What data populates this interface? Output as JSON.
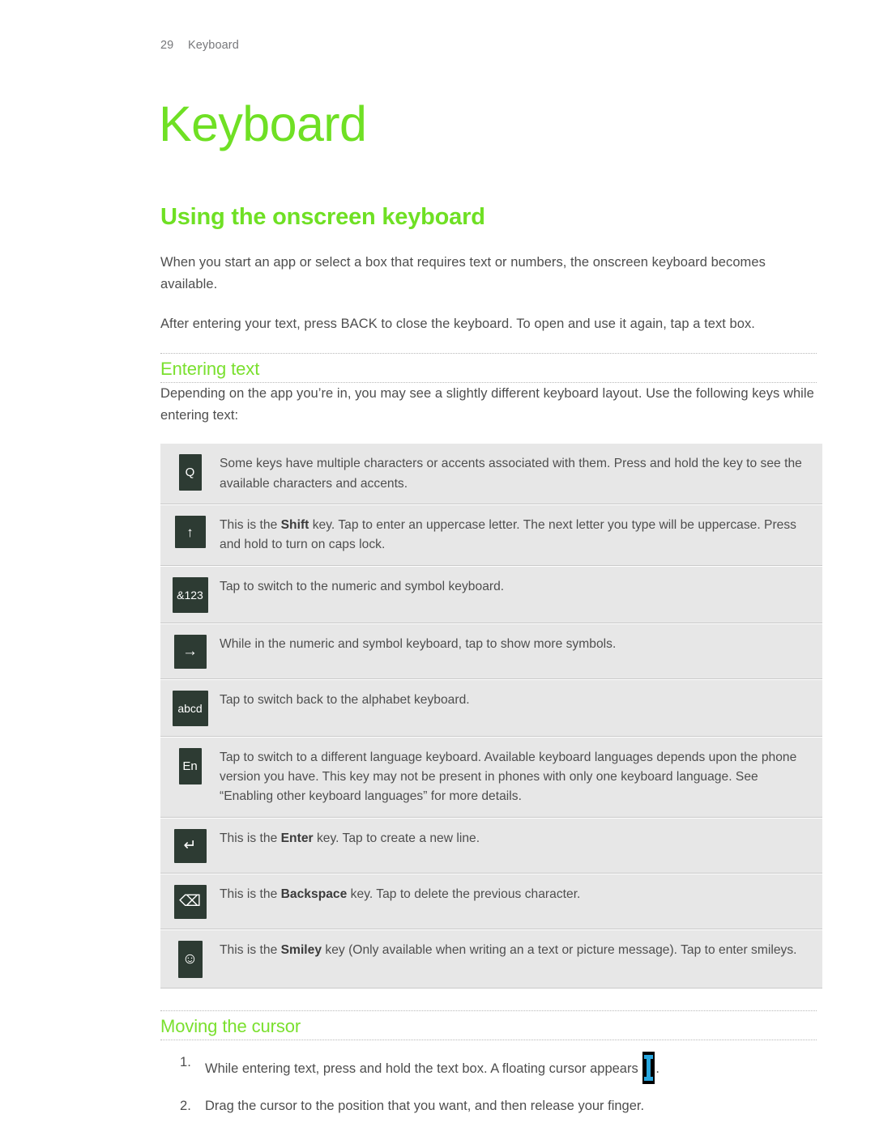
{
  "header": {
    "page_number": "29",
    "chapter_label": "Keyboard"
  },
  "chapter_title": "Keyboard",
  "section": {
    "heading": "Using the onscreen keyboard",
    "paragraphs": [
      "When you start an app or select a box that requires text or numbers, the onscreen keyboard becomes available.",
      "After entering your text, press BACK to close the keyboard. To open and use it again, tap a text box."
    ]
  },
  "entering_text": {
    "heading": "Entering text",
    "intro": "Depending on the app you’re in, you may see a slightly different keyboard layout. Use the following keys while entering text:",
    "rows": [
      {
        "key_label": "Q",
        "key_icon": "letter-q-key-icon",
        "key_style": "narrow",
        "desc_pre": "Some keys have multiple characters or accents associated with them. Press and hold the key to see the available characters and accents.",
        "desc_bold": "",
        "desc_post": ""
      },
      {
        "key_label": "↑",
        "key_icon": "shift-arrow-up-key-icon",
        "key_style": "square",
        "desc_pre": "This is the ",
        "desc_bold": "Shift",
        "desc_post": " key. Tap to enter an uppercase letter. The next letter you type will be uppercase. Press and hold to turn on caps lock."
      },
      {
        "key_label": "&123",
        "key_icon": "numeric-symbol-key-icon",
        "key_style": "wide",
        "desc_pre": "Tap to switch to the numeric and symbol keyboard.",
        "desc_bold": "",
        "desc_post": ""
      },
      {
        "key_label": "→",
        "key_icon": "arrow-right-more-symbols-key-icon",
        "key_style": "arrow",
        "desc_pre": "While in the numeric and symbol keyboard, tap to show more symbols.",
        "desc_bold": "",
        "desc_post": ""
      },
      {
        "key_label": "abcd",
        "key_icon": "alphabet-key-icon",
        "key_style": "wide",
        "desc_pre": "Tap to switch back to the alphabet keyboard.",
        "desc_bold": "",
        "desc_post": ""
      },
      {
        "key_label": "En",
        "key_icon": "language-en-key-icon",
        "key_style": "narrow",
        "desc_pre": "Tap to switch to a different language keyboard. Available keyboard languages depends upon the phone version you have. This key may not be present in phones with only one keyboard language. See “Enabling other keyboard languages” for more details.",
        "desc_bold": "",
        "desc_post": ""
      },
      {
        "key_label": "↵",
        "key_icon": "enter-return-key-icon",
        "key_style": "arrow",
        "desc_pre": "This is the ",
        "desc_bold": "Enter",
        "desc_post": " key. Tap to create a new line."
      },
      {
        "key_label": "⌫",
        "key_icon": "backspace-key-icon",
        "key_style": "arrow",
        "desc_pre": "This is the ",
        "desc_bold": "Backspace",
        "desc_post": " key. Tap to delete the previous character."
      },
      {
        "key_label": "☺",
        "key_icon": "smiley-key-icon",
        "key_style": "smiley",
        "desc_pre": "This is the ",
        "desc_bold": "Smiley",
        "desc_post": " key (Only available when writing an a text or picture message). Tap to enter smileys."
      }
    ]
  },
  "moving_cursor": {
    "heading": "Moving the cursor",
    "step_1_pre": "While entering text, press and hold the text box. A floating cursor appears ",
    "step_1_post": ".",
    "step_2": "Drag the cursor to the position that you want, and then release your finger."
  },
  "colors": {
    "accent_green": "#6fe024",
    "subheading_green": "#7ae02e",
    "key_background": "#2d3b33",
    "row_background": "#e7e7e7",
    "cursor_blue": "#29a8e0",
    "body_text": "#4e4e4e"
  }
}
